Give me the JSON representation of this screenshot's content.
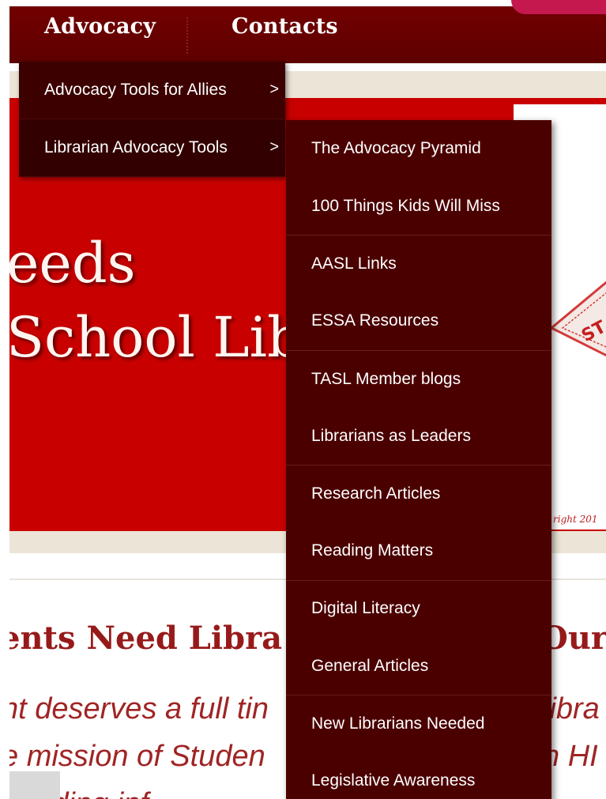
{
  "nav": {
    "advocacy": "Advocacy",
    "contacts": "Contacts"
  },
  "hero": {
    "line1": "eeds",
    "line2": "School Libr",
    "stamp_text": "ST",
    "copyright": "right 201"
  },
  "article": {
    "title_left": "ents Need Libra",
    "title_right": "Our",
    "line1_left": "nt deserves a full tin",
    "line1_right": "libra",
    "line2_left": "e mission of Studen",
    "line2_right": "n HI",
    "line3_left": "      proiding inf"
  },
  "menu_level1": [
    {
      "label": "Advocacy Tools for Allies",
      "arrow": ">"
    },
    {
      "label": "Librarian Advocacy Tools",
      "arrow": ">"
    }
  ],
  "menu_level2": [
    {
      "label": "The Advocacy Pyramid"
    },
    {
      "label": "100 Things Kids Will Miss"
    },
    {
      "label": "AASL Links"
    },
    {
      "label": "ESSA Resources"
    },
    {
      "label": "TASL Member blogs"
    },
    {
      "label": "Librarians as Leaders"
    },
    {
      "label": "Research Articles"
    },
    {
      "label": "Reading Matters"
    },
    {
      "label": "Digital Literacy"
    },
    {
      "label": "General Articles"
    },
    {
      "label": "New Librarians Needed"
    },
    {
      "label": "Legislative Awareness"
    }
  ],
  "colors": {
    "nav_bg": "#6a0000",
    "menu1_bg": "#3d0000",
    "menu2_bg": "#4b0000",
    "hero_red": "#c90000",
    "heading_red": "#971a1a"
  }
}
